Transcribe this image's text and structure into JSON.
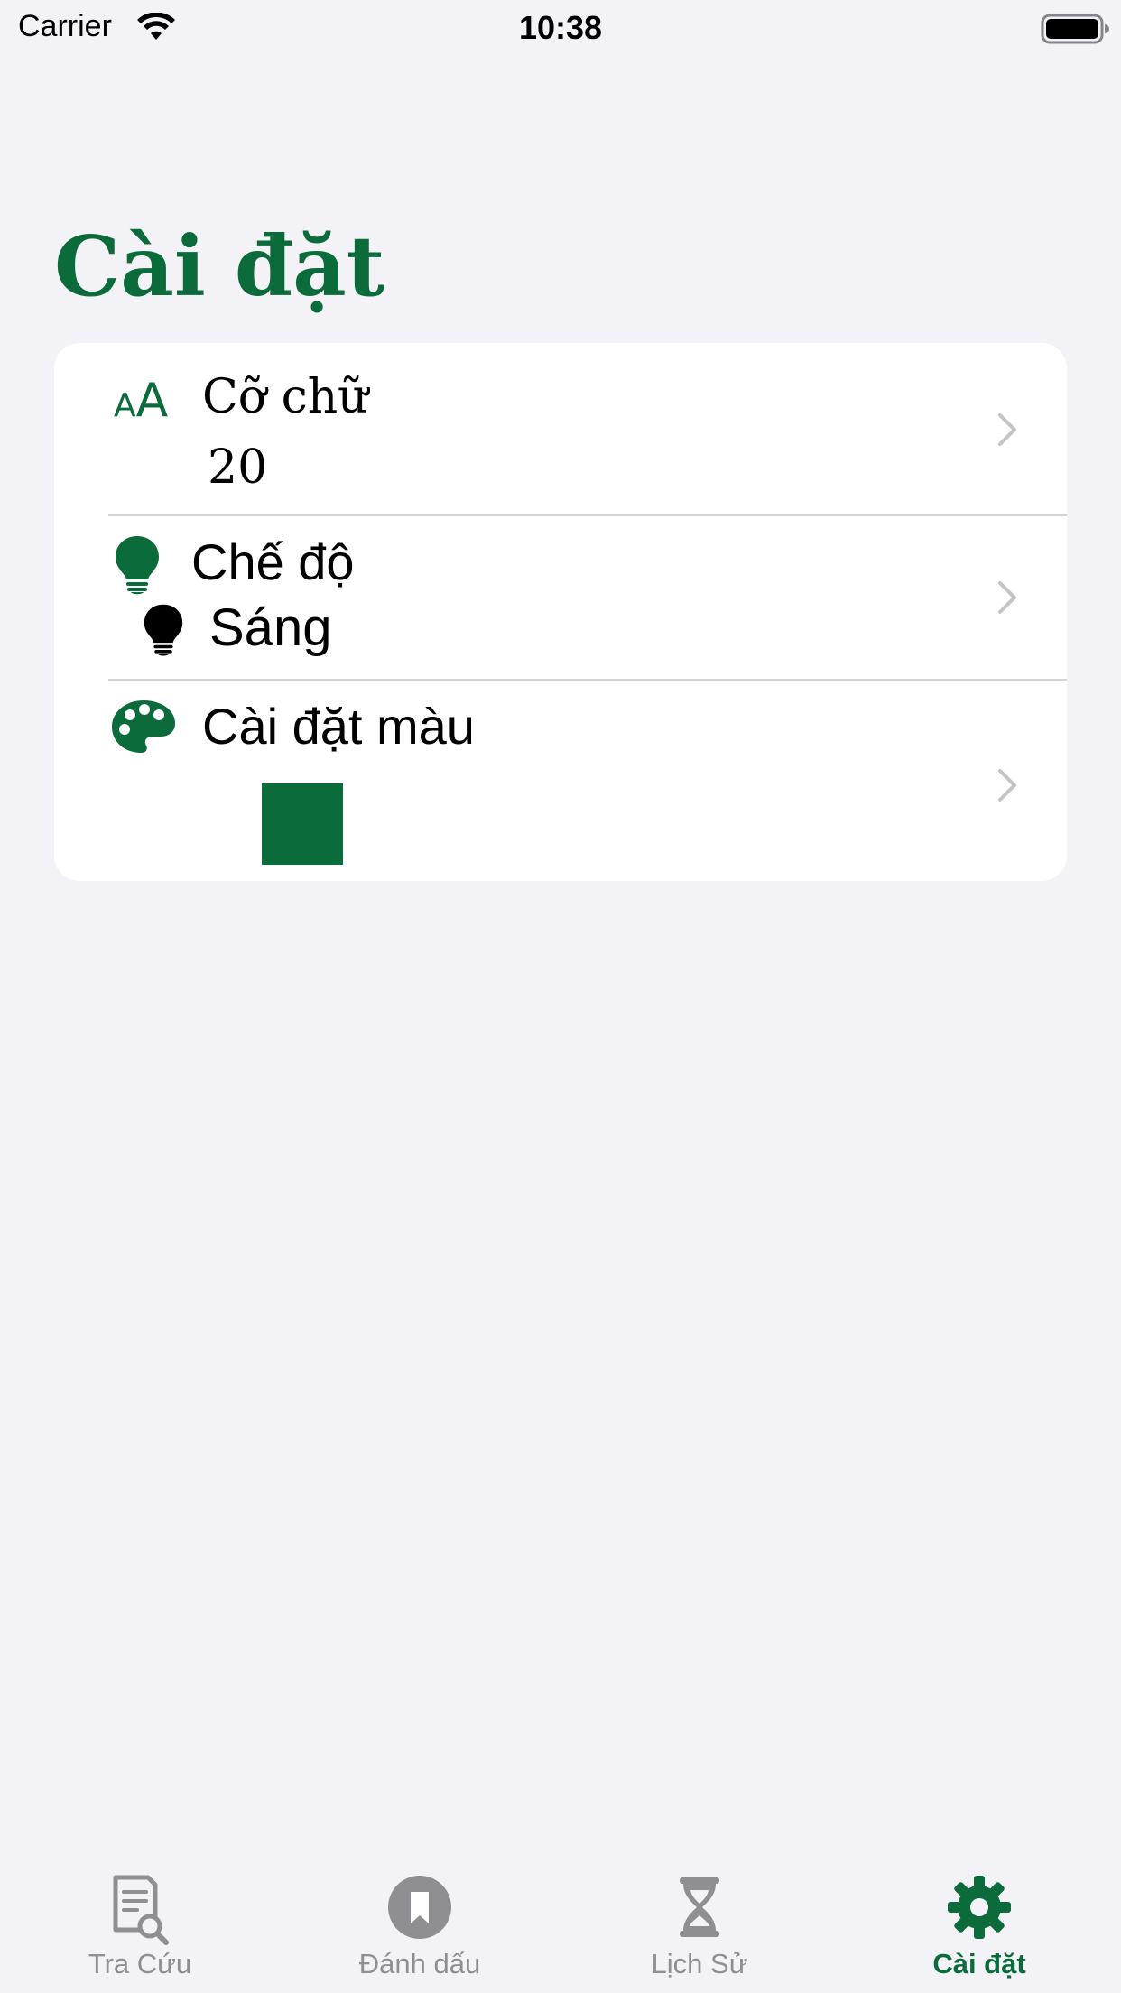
{
  "status_bar": {
    "carrier": "Carrier",
    "time": "10:38",
    "wifi_icon": "wifi-icon",
    "battery_icon": "battery-full-icon"
  },
  "header": {
    "title": "Cài đặt"
  },
  "settings": {
    "font_size": {
      "icon": "font-size-icon",
      "icon_small": "A",
      "icon_big": "A",
      "label": "Cỡ chữ",
      "value": "20"
    },
    "mode": {
      "icon": "lightbulb-icon",
      "label": "Chế độ",
      "value_icon": "lightbulb-icon",
      "value": "Sáng"
    },
    "color": {
      "icon": "palette-icon",
      "label": "Cài đặt màu",
      "swatch_color": "#0B6B3A"
    }
  },
  "tab_bar": {
    "tabs": [
      {
        "label": "Tra Cứu",
        "icon": "document-search-icon"
      },
      {
        "label": "Đánh dấu",
        "icon": "bookmark-icon"
      },
      {
        "label": "Lịch Sử",
        "icon": "hourglass-icon"
      },
      {
        "label": "Cài đặt",
        "icon": "gear-icon"
      }
    ],
    "active_index": 3
  },
  "colors": {
    "accent": "#0B6B3A",
    "background": "#F2F2F7",
    "card": "#FFFFFF",
    "inactive": "#8E8E93"
  }
}
